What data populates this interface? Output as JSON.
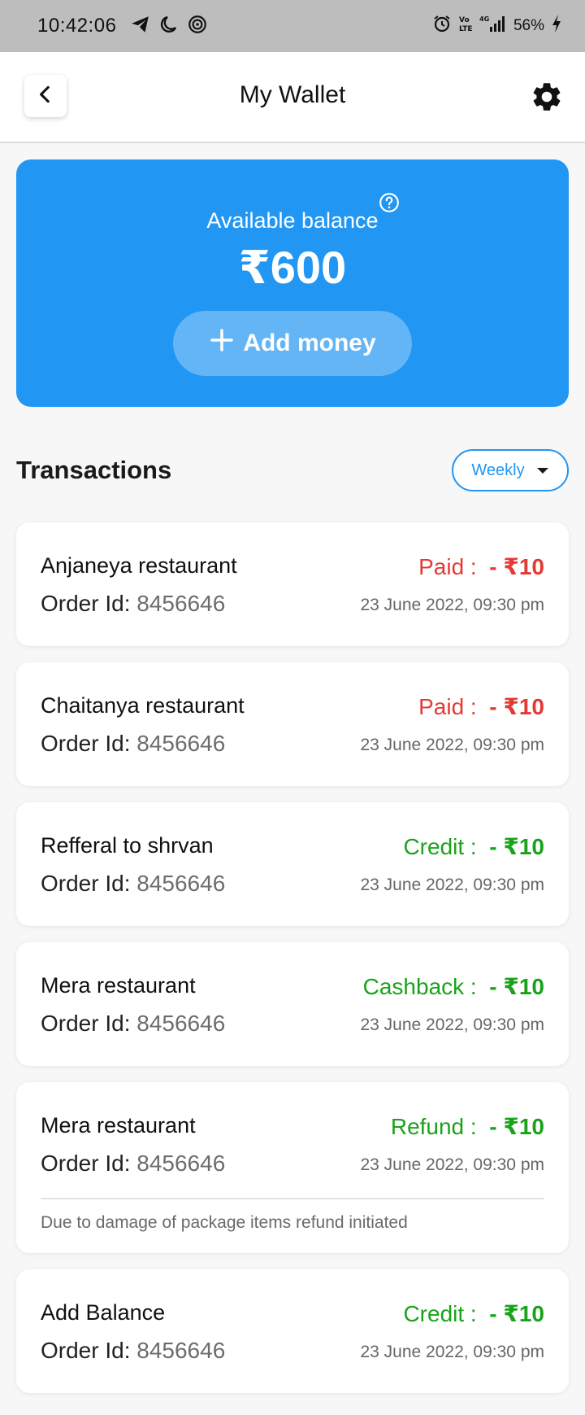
{
  "status_bar": {
    "time": "10:42:06",
    "battery": "56%",
    "network": "4G"
  },
  "header": {
    "title": "My Wallet"
  },
  "balance": {
    "label": "Available balance",
    "amount": "₹600",
    "add_money_label": "Add money"
  },
  "transactions": {
    "title": "Transactions",
    "filter": "Weekly",
    "items": [
      {
        "name": "Anjaneya restaurant",
        "order_label": "Order Id:",
        "order_id": "8456646",
        "status": "Paid :",
        "amount": "- ₹10",
        "date": "23 June 2022, 09:30 pm"
      },
      {
        "name": "Chaitanya restaurant",
        "order_label": "Order Id:",
        "order_id": "8456646",
        "status": "Paid :",
        "amount": "- ₹10",
        "date": "23 June 2022, 09:30 pm"
      },
      {
        "name": "Refferal to shrvan",
        "order_label": "Order Id:",
        "order_id": "8456646",
        "status": "Credit :",
        "amount": "- ₹10",
        "date": "23 June 2022, 09:30 pm"
      },
      {
        "name": "Mera restaurant",
        "order_label": "Order Id:",
        "order_id": "8456646",
        "status": "Cashback :",
        "amount": "- ₹10",
        "date": "23 June 2022, 09:30 pm"
      },
      {
        "name": "Mera restaurant",
        "order_label": "Order Id:",
        "order_id": "8456646",
        "status": "Refund :",
        "amount": "- ₹10",
        "date": "23 June 2022, 09:30 pm",
        "note": "Due to damage of package items refund initiated"
      },
      {
        "name": "Add Balance",
        "order_label": "Order Id:",
        "order_id": "8456646",
        "status": "Credit :",
        "amount": "- ₹10",
        "date": "23 June 2022, 09:30 pm"
      }
    ]
  },
  "colors": {
    "accent": "#2196f3",
    "paid": "#e53935",
    "credit": "#1aa31a"
  }
}
